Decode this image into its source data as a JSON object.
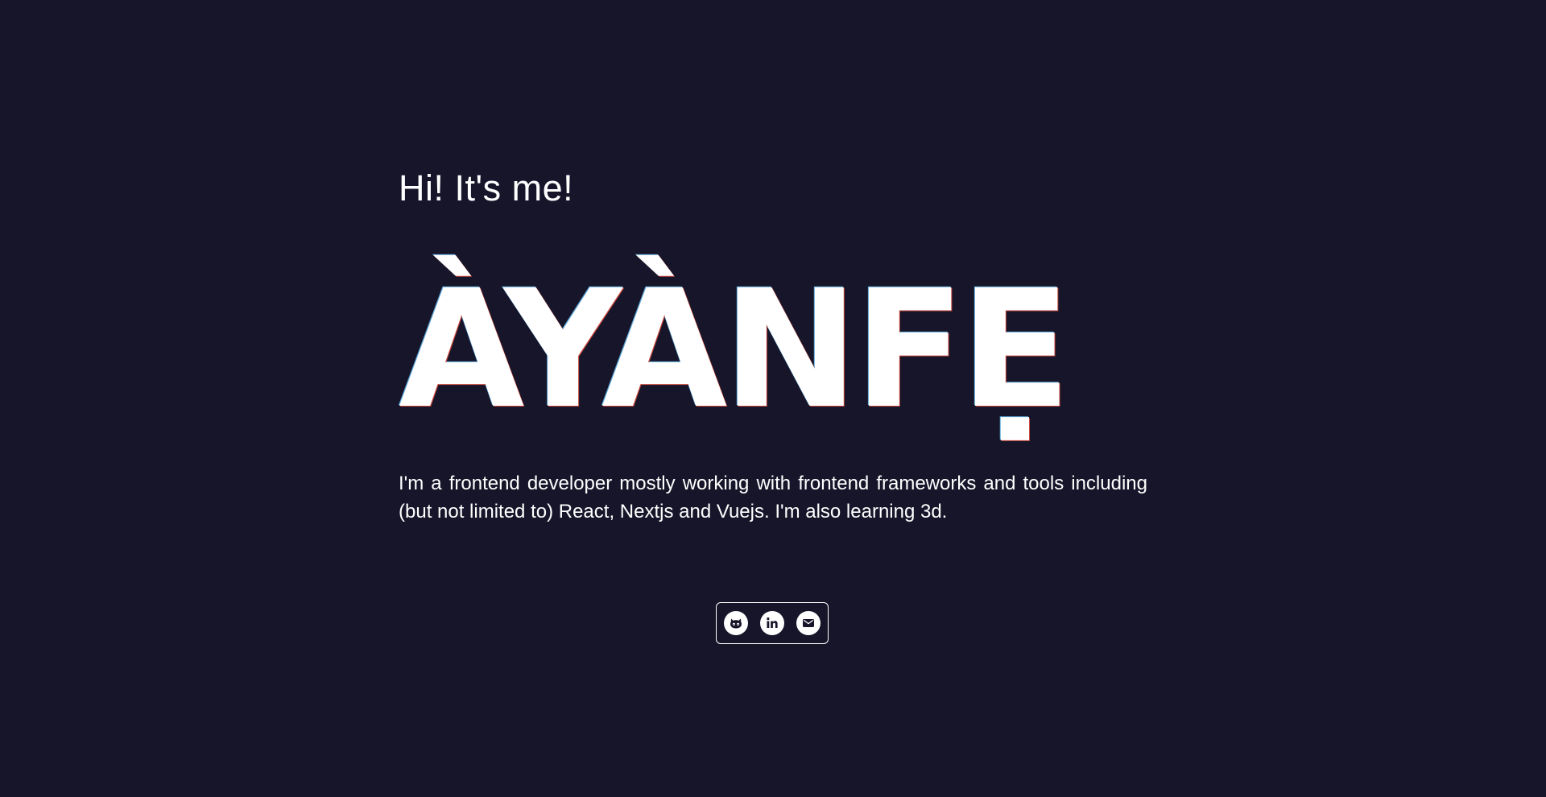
{
  "hero": {
    "greeting": "Hi! It's me!",
    "name": "ÀYÀNFẸ",
    "bio": "I'm a frontend developer mostly working with frontend frameworks and tools including (but not limited to) React, Nextjs and Vuejs. I'm also learning 3d."
  },
  "socials": [
    {
      "icon": "github-icon"
    },
    {
      "icon": "linkedin-icon"
    },
    {
      "icon": "mail-icon"
    }
  ],
  "colors": {
    "background": "#16152a",
    "text": "#ffffff",
    "icon_fill": "#16152a"
  }
}
